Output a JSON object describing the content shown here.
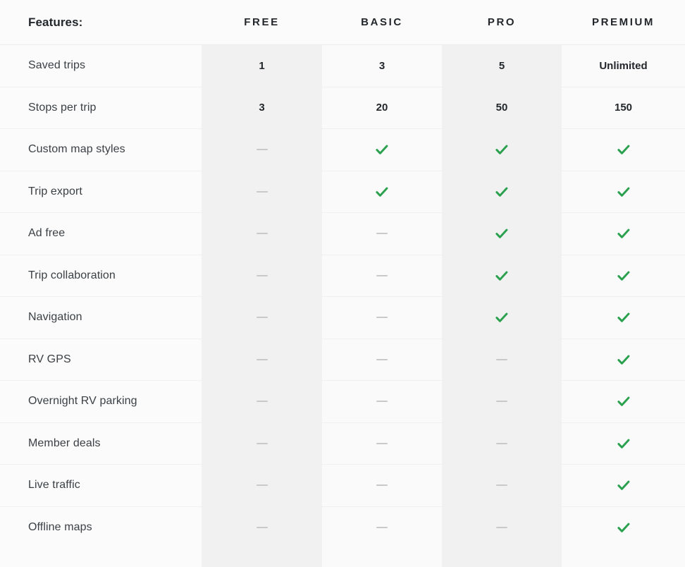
{
  "table": {
    "features_label": "Features:",
    "plans": [
      {
        "key": "free",
        "label": "FREE"
      },
      {
        "key": "basic",
        "label": "BASIC"
      },
      {
        "key": "pro",
        "label": "PRO"
      },
      {
        "key": "premium",
        "label": "PREMIUM"
      }
    ],
    "colors": {
      "check": "#2ba14f",
      "dash": "#c9c9c9",
      "shaded_column": "#f1f1f1",
      "plain_column": "#fafafa",
      "page_background": "#fbfbfb",
      "heading_text": "#23272b",
      "feature_text": "#3b4045",
      "row_divider": "#f0f0f0"
    },
    "icons": {
      "check": "check-icon",
      "dash": "dash-icon"
    },
    "rows": [
      {
        "feature": "Saved trips",
        "values": [
          {
            "type": "text",
            "text": "1"
          },
          {
            "type": "text",
            "text": "3"
          },
          {
            "type": "text",
            "text": "5"
          },
          {
            "type": "text",
            "text": "Unlimited"
          }
        ]
      },
      {
        "feature": "Stops per trip",
        "values": [
          {
            "type": "text",
            "text": "3"
          },
          {
            "type": "text",
            "text": "20"
          },
          {
            "type": "text",
            "text": "50"
          },
          {
            "type": "text",
            "text": "150"
          }
        ]
      },
      {
        "feature": "Custom map styles",
        "values": [
          {
            "type": "dash",
            "text": ""
          },
          {
            "type": "check",
            "text": ""
          },
          {
            "type": "check",
            "text": ""
          },
          {
            "type": "check",
            "text": ""
          }
        ]
      },
      {
        "feature": "Trip export",
        "values": [
          {
            "type": "dash",
            "text": ""
          },
          {
            "type": "check",
            "text": ""
          },
          {
            "type": "check",
            "text": ""
          },
          {
            "type": "check",
            "text": ""
          }
        ]
      },
      {
        "feature": "Ad free",
        "values": [
          {
            "type": "dash",
            "text": ""
          },
          {
            "type": "dash",
            "text": ""
          },
          {
            "type": "check",
            "text": ""
          },
          {
            "type": "check",
            "text": ""
          }
        ]
      },
      {
        "feature": "Trip collaboration",
        "values": [
          {
            "type": "dash",
            "text": ""
          },
          {
            "type": "dash",
            "text": ""
          },
          {
            "type": "check",
            "text": ""
          },
          {
            "type": "check",
            "text": ""
          }
        ]
      },
      {
        "feature": "Navigation",
        "values": [
          {
            "type": "dash",
            "text": ""
          },
          {
            "type": "dash",
            "text": ""
          },
          {
            "type": "check",
            "text": ""
          },
          {
            "type": "check",
            "text": ""
          }
        ]
      },
      {
        "feature": "RV GPS",
        "values": [
          {
            "type": "dash",
            "text": ""
          },
          {
            "type": "dash",
            "text": ""
          },
          {
            "type": "dash",
            "text": ""
          },
          {
            "type": "check",
            "text": ""
          }
        ]
      },
      {
        "feature": "Overnight RV parking",
        "values": [
          {
            "type": "dash",
            "text": ""
          },
          {
            "type": "dash",
            "text": ""
          },
          {
            "type": "dash",
            "text": ""
          },
          {
            "type": "check",
            "text": ""
          }
        ]
      },
      {
        "feature": "Member deals",
        "values": [
          {
            "type": "dash",
            "text": ""
          },
          {
            "type": "dash",
            "text": ""
          },
          {
            "type": "dash",
            "text": ""
          },
          {
            "type": "check",
            "text": ""
          }
        ]
      },
      {
        "feature": "Live traffic",
        "values": [
          {
            "type": "dash",
            "text": ""
          },
          {
            "type": "dash",
            "text": ""
          },
          {
            "type": "dash",
            "text": ""
          },
          {
            "type": "check",
            "text": ""
          }
        ]
      },
      {
        "feature": "Offline maps",
        "values": [
          {
            "type": "dash",
            "text": ""
          },
          {
            "type": "dash",
            "text": ""
          },
          {
            "type": "dash",
            "text": ""
          },
          {
            "type": "check",
            "text": ""
          }
        ]
      }
    ]
  }
}
